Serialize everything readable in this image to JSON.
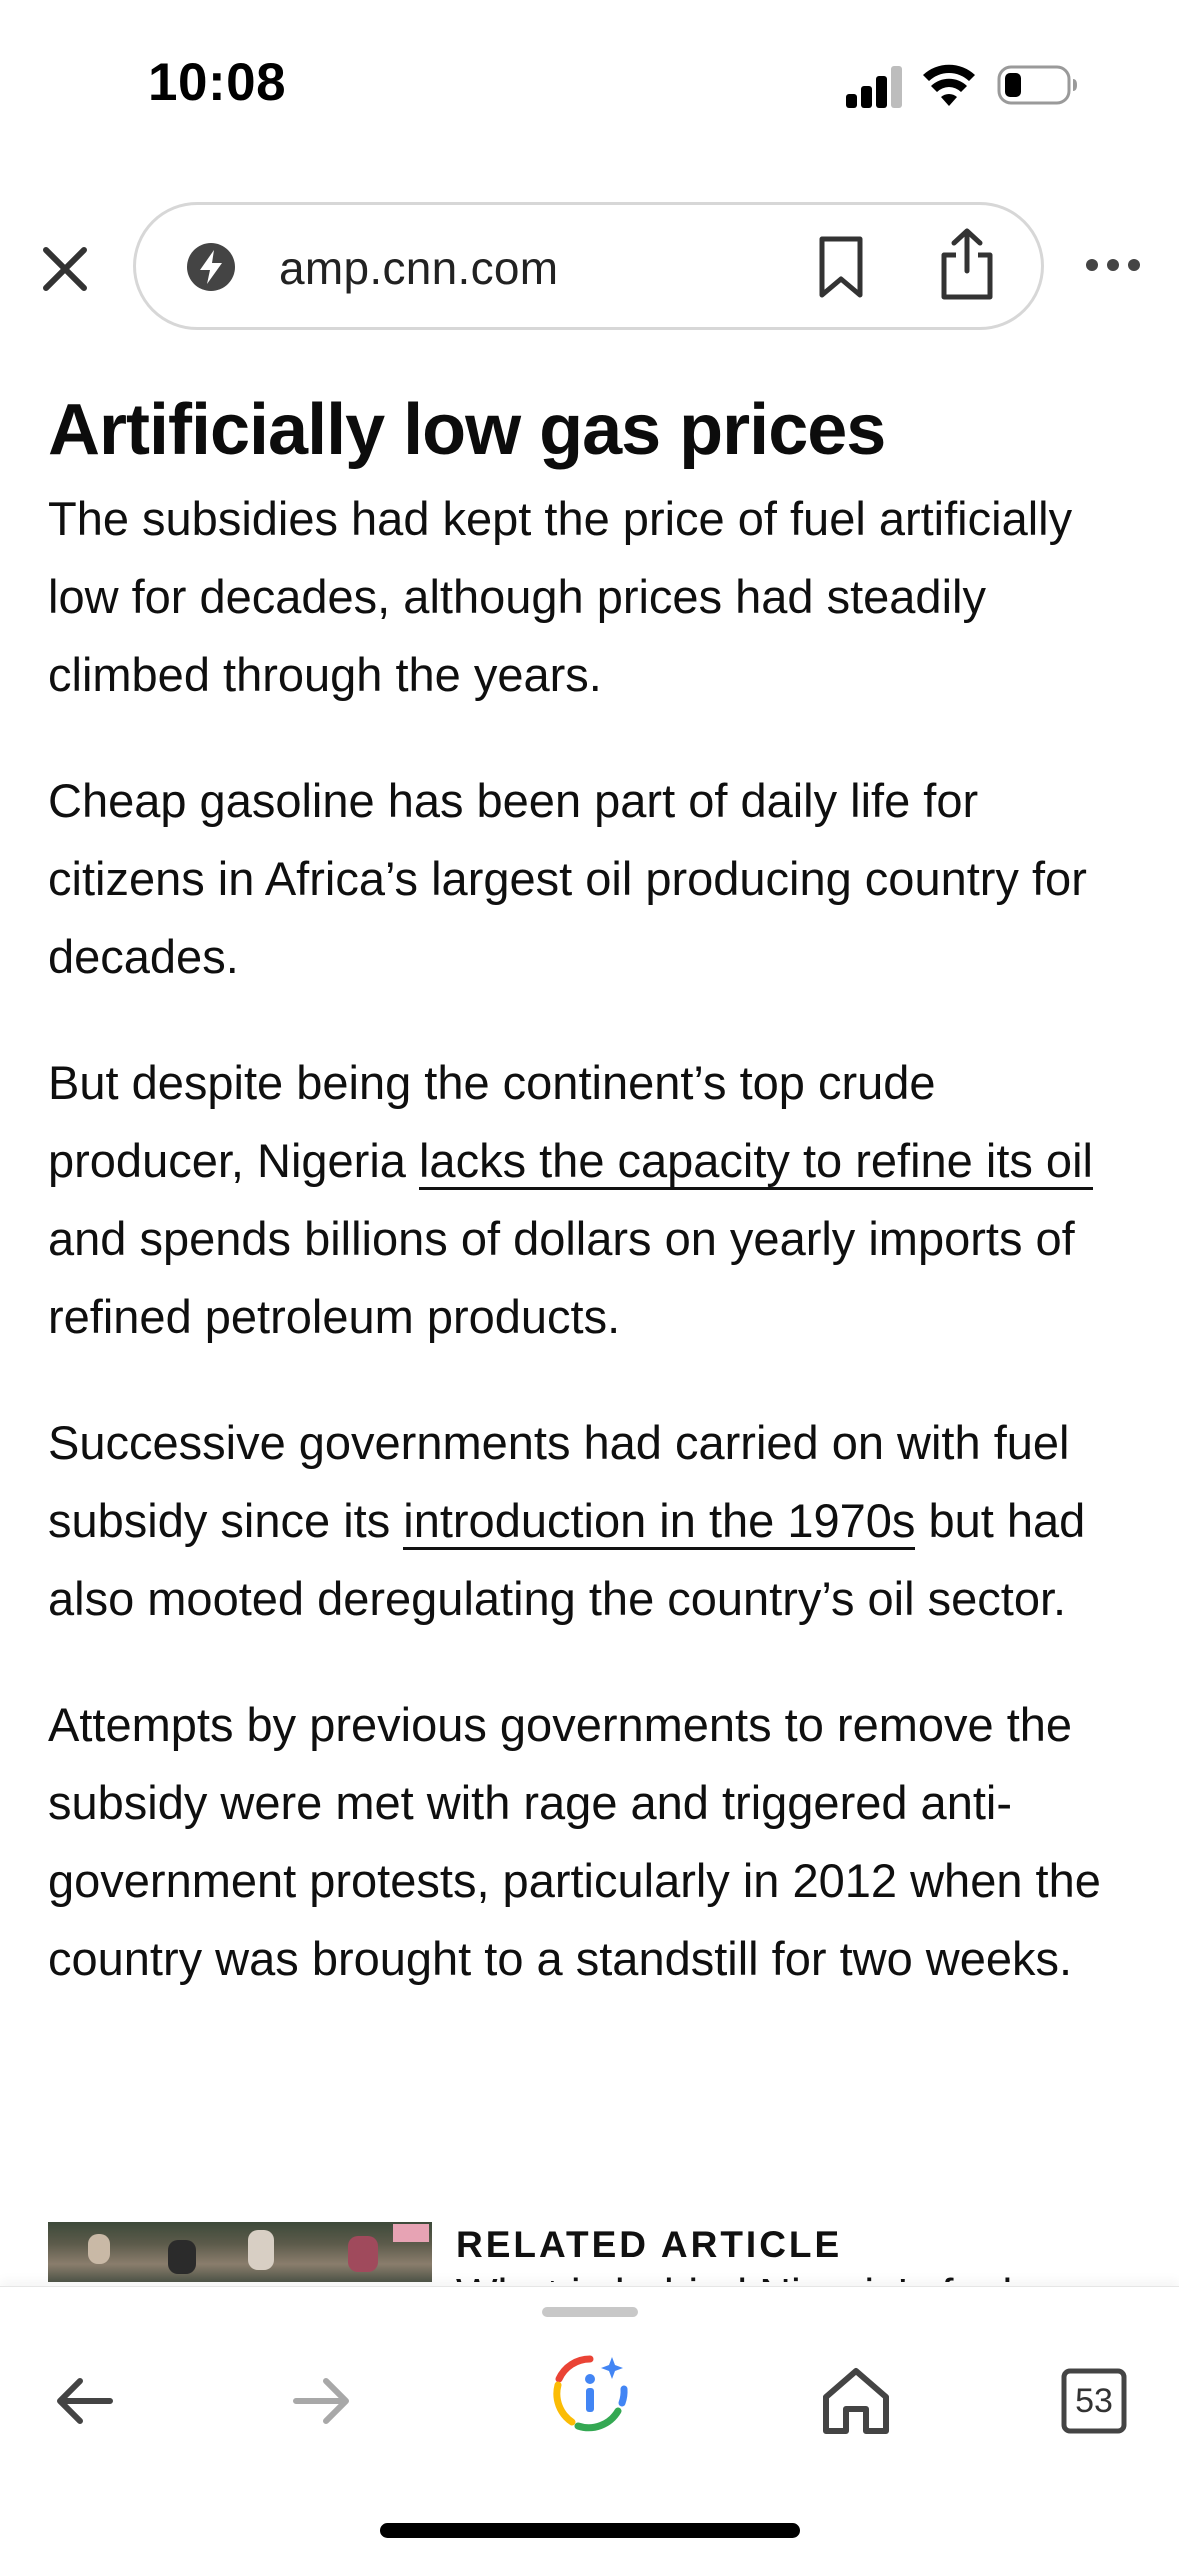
{
  "status_bar": {
    "time": "10:08"
  },
  "browser": {
    "url": "amp.cnn.com",
    "icons": {
      "close": "close-icon",
      "site_info": "bolt-icon",
      "bookmark": "bookmark-icon",
      "share": "share-icon",
      "more": "more-icon"
    }
  },
  "article": {
    "heading": "Artificially low gas prices",
    "p1": "The subsidies had kept the price of fuel artificially low for decades, although prices had steadily climbed through the years.",
    "p2": "Cheap gasoline has been part of daily life for citizens in Africa’s largest oil producing country for decades.",
    "p3_before": "But despite being the continent’s top crude producer, Nigeria ",
    "p3_link": "lacks the capacity to refine its oil",
    "p3_after": " and spends billions of dollars on yearly imports of refined petroleum products.",
    "p4_before": "Successive governments had carried on with fuel subsidy since its ",
    "p4_link": "introduction in the 1970s",
    "p4_after": " but had also mooted deregulating the country’s oil sector.",
    "p5": "Attempts by previous governments to remove the subsidy were met with rage and triggered anti-government protests, particularly in 2012 when the country was brought to a standstill for two weeks."
  },
  "related": {
    "label": "RELATED ARTICLE",
    "headline": "What is behind Nigeria's fuel"
  },
  "bottom_bar": {
    "tab_count": "53",
    "icons": {
      "back": "back-arrow-icon",
      "forward": "forward-arrow-icon",
      "lens": "google-lens-icon",
      "home": "home-icon",
      "tabs": "tabs-icon"
    }
  },
  "colors": {
    "text": "#0f0f0f",
    "pill_border": "#d7d7d7",
    "forward_disabled": "#a8a8a8",
    "google_blue": "#4285F4",
    "google_red": "#EA4335",
    "google_yellow": "#FBBC05",
    "google_green": "#34A853"
  }
}
